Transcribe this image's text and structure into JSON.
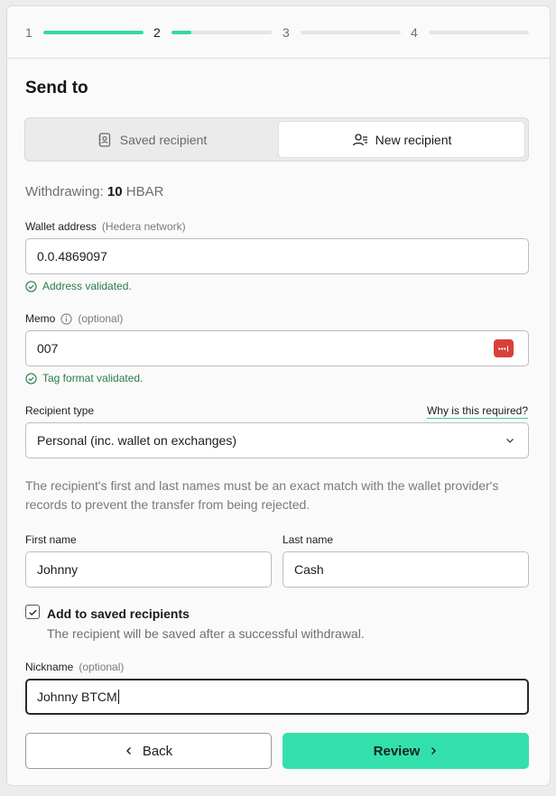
{
  "stepper": {
    "steps": [
      {
        "num": "1",
        "progress": 1.0
      },
      {
        "num": "2",
        "progress": 0.2
      },
      {
        "num": "3",
        "progress": 0
      },
      {
        "num": "4",
        "progress": 0
      }
    ],
    "active_step": "2",
    "accent_color": "#34d8a8"
  },
  "title": "Send to",
  "tabs": {
    "saved": "Saved recipient",
    "new": "New recipient",
    "selected": "new"
  },
  "withdrawing": {
    "label": "Withdrawing:",
    "amount": "10",
    "currency": "HBAR"
  },
  "wallet": {
    "label": "Wallet address",
    "hint": "(Hedera network)",
    "value": "0.0.4869097",
    "validation": "Address validated."
  },
  "memo": {
    "label": "Memo",
    "hint": "(optional)",
    "value": "007",
    "validation": "Tag format validated.",
    "icon": "info-icon"
  },
  "recipient_type": {
    "label": "Recipient type",
    "help_link": "Why is this required?",
    "selected": "Personal (inc. wallet on exchanges)"
  },
  "note": "The recipient's first and last names must be an exact match with the wallet provider's records to prevent the transfer from being rejected.",
  "first_name": {
    "label": "First name",
    "value": "Johnny"
  },
  "last_name": {
    "label": "Last name",
    "value": "Cash"
  },
  "save_option": {
    "label": "Add to saved recipients",
    "help": "The recipient will be saved after a successful withdrawal.",
    "checked": true
  },
  "nickname": {
    "label": "Nickname",
    "hint": "(optional)",
    "value": "Johnny BTCM"
  },
  "buttons": {
    "back": "Back",
    "review": "Review"
  },
  "colors": {
    "accent": "#33e0ac",
    "valid": "#2b7a4b",
    "password_manager": "#d9403a"
  }
}
